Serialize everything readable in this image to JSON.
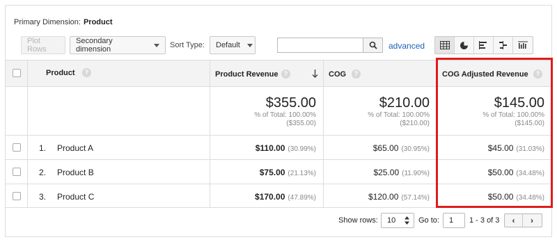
{
  "primary_dimension": {
    "label": "Primary Dimension:",
    "value": "Product"
  },
  "toolbar": {
    "plot_rows": "Plot Rows",
    "secondary_dimension": "Secondary dimension",
    "sort_type_label": "Sort Type:",
    "sort_type_value": "Default",
    "search_value": "",
    "advanced": "advanced",
    "view_icons": [
      "table-view-icon",
      "pie-view-icon",
      "performance-view-icon",
      "comparison-view-icon",
      "pivot-view-icon"
    ]
  },
  "table": {
    "headers": {
      "product": "Product",
      "product_revenue": "Product Revenue",
      "cog": "COG",
      "cog_adjusted": "COG Adjusted Revenue",
      "help_glyph": "?"
    },
    "totals": {
      "product_revenue": {
        "value": "$355.00",
        "pct": "% of Total: 100.00%",
        "abs": "($355.00)"
      },
      "cog": {
        "value": "$210.00",
        "pct": "% of Total: 100.00%",
        "abs": "($210.00)"
      },
      "cog_adjusted": {
        "value": "$145.00",
        "pct": "% of Total: 100.00%",
        "abs": "($145.00)"
      }
    },
    "rows": [
      {
        "rank": "1.",
        "product": "Product A",
        "revenue": "$110.00",
        "revenue_share": "(30.99%)",
        "cog": "$65.00",
        "cog_share": "(30.95%)",
        "adj": "$45.00",
        "adj_share": "(31.03%)"
      },
      {
        "rank": "2.",
        "product": "Product B",
        "revenue": "$75.00",
        "revenue_share": "(21.13%)",
        "cog": "$25.00",
        "cog_share": "(11.90%)",
        "adj": "$50.00",
        "adj_share": "(34.48%)"
      },
      {
        "rank": "3.",
        "product": "Product C",
        "revenue": "$170.00",
        "revenue_share": "(47.89%)",
        "cog": "$120.00",
        "cog_share": "(57.14%)",
        "adj": "$50.00",
        "adj_share": "(34.48%)"
      }
    ]
  },
  "footer": {
    "show_rows_label": "Show rows:",
    "show_rows_value": "10",
    "goto_label": "Go to:",
    "goto_value": "1",
    "range": "1 - 3 of 3",
    "prev": "‹",
    "next": "›"
  },
  "colors": {
    "highlight": "#e01b1b",
    "link": "#1a63b5",
    "header_bg": "#f3f3f3"
  }
}
